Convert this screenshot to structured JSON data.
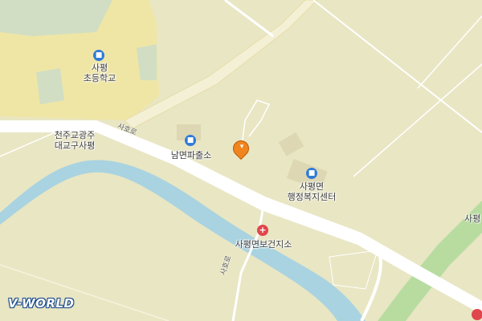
{
  "map": {
    "labels": {
      "school_line1": "사평",
      "school_line2": "초등학교",
      "police": "남면파출소",
      "office_line1": "사평면",
      "office_line2": "행정복지센터",
      "health": "사평면보건지소",
      "church_line1": "천주교광주",
      "church_line2": "대교구사평",
      "edge_label": "사평"
    },
    "road_names": {
      "upper": "사호로",
      "lower": "사호로"
    },
    "logo": "V-WORLD",
    "icons": {
      "school": "school-icon",
      "police": "police-icon",
      "office": "government-office-icon",
      "health": "health-center-icon",
      "marker": "location-marker-icon"
    },
    "colors": {
      "land": "#e9e6c4",
      "road": "#ffffff",
      "river": "#a9d3e0",
      "green": "#b8dca0",
      "poi_blue": "#2f7bd8",
      "health_red": "#e0474c",
      "marker_orange": "#f0841f"
    }
  }
}
